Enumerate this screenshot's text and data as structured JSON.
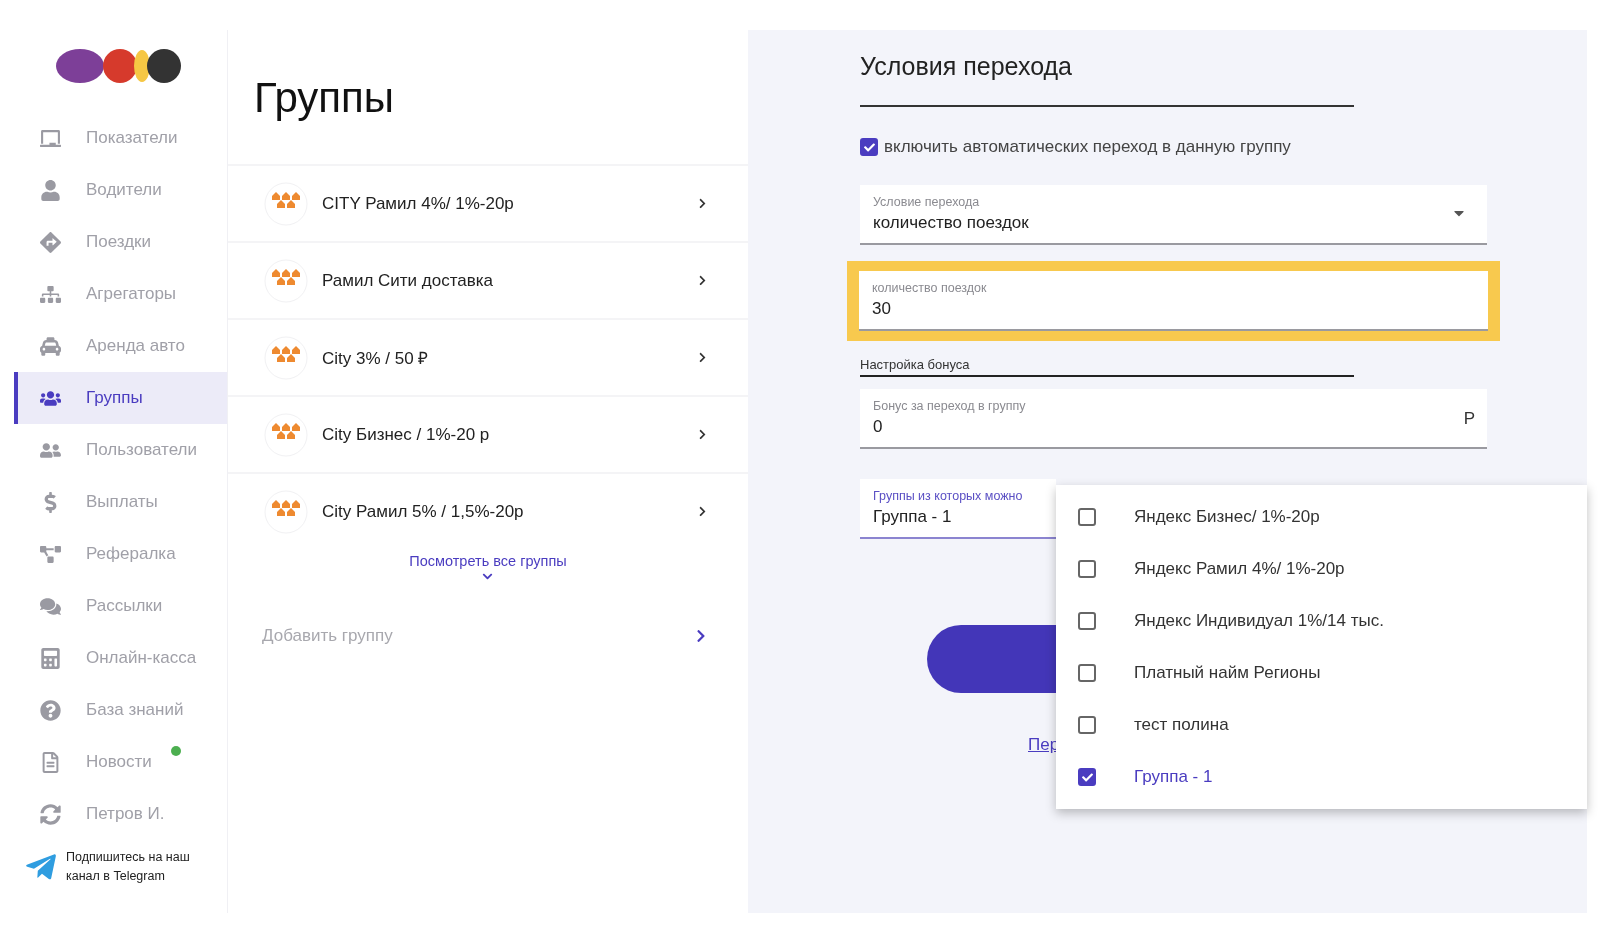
{
  "sidebar": {
    "items": [
      {
        "label": "Показатели",
        "selected": false,
        "notification": false
      },
      {
        "label": "Водители",
        "selected": false,
        "notification": false
      },
      {
        "label": "Поездки",
        "selected": false,
        "notification": false
      },
      {
        "label": "Агрегаторы",
        "selected": false,
        "notification": false
      },
      {
        "label": "Аренда авто",
        "selected": false,
        "notification": false
      },
      {
        "label": "Группы",
        "selected": true,
        "notification": false
      },
      {
        "label": "Пользователи",
        "selected": false,
        "notification": false
      },
      {
        "label": "Выплаты",
        "selected": false,
        "notification": false
      },
      {
        "label": "Рефералка",
        "selected": false,
        "notification": false
      },
      {
        "label": "Рассылки",
        "selected": false,
        "notification": false
      },
      {
        "label": "Онлайн-касса",
        "selected": false,
        "notification": false
      },
      {
        "label": "База знаний",
        "selected": false,
        "notification": false
      },
      {
        "label": "Новости",
        "selected": false,
        "notification": true
      },
      {
        "label": "Петров И.",
        "selected": false,
        "notification": false
      }
    ],
    "telegram": "Подпишитесь на наш канал в Telegram"
  },
  "groups": {
    "title": "Группы",
    "items": [
      {
        "name": "CITY Рамил 4%/ 1%-20р"
      },
      {
        "name": "Рамил Сити доставка"
      },
      {
        "name": "City 3% / 50 ₽"
      },
      {
        "name": "City Бизнес / 1%-20 р"
      },
      {
        "name": "City Рамил 5% / 1,5%-20р"
      }
    ],
    "show_all": "Посмотреть все группы",
    "add": "Добавить группу"
  },
  "conditions": {
    "title": "Условия перехода",
    "auto_transition": {
      "label": "включить автоматических переход в данную группу",
      "checked": true
    },
    "condition_select": {
      "label": "Условие перехода",
      "value": "количество поездок"
    },
    "trips_field": {
      "label": "количество поездок",
      "value": "30",
      "highlighted": true
    },
    "bonus_section": "Настройка бонуса",
    "bonus_field": {
      "label": "Бонус за переход в группу",
      "value": "0",
      "unit": "Р"
    },
    "source_groups_field": {
      "label": "Группы из которых можно",
      "value": "Группа - 1"
    },
    "link": "Пер",
    "dropdown": [
      {
        "label": "Яндекс Бизнес/ 1%-20р",
        "checked": false
      },
      {
        "label": "Яндекс Рамил 4%/ 1%-20р",
        "checked": false
      },
      {
        "label": "Яндекс Индивидуал 1%/14 тыс.",
        "checked": false
      },
      {
        "label": "Платный найм Регионы",
        "checked": false
      },
      {
        "label": "тест полина",
        "checked": false
      },
      {
        "label": "Группа - 1",
        "checked": true
      }
    ]
  }
}
